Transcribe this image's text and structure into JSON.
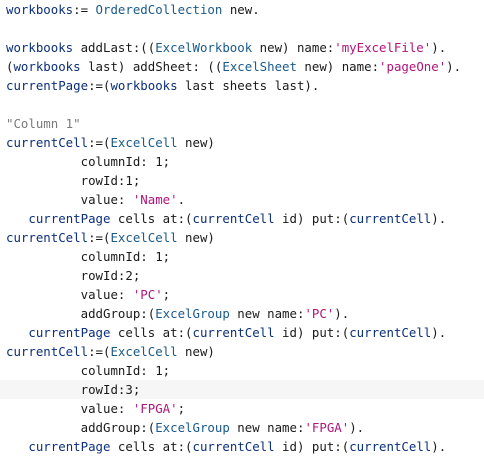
{
  "editor": {
    "lines": [
      {
        "indent": "",
        "tokens": [
          [
            "v",
            "workbooks"
          ],
          [
            "n",
            ":= "
          ],
          [
            "c",
            "OrderedCollection"
          ],
          [
            "n",
            " new."
          ]
        ]
      },
      {
        "indent": "",
        "tokens": []
      },
      {
        "indent": "",
        "tokens": [
          [
            "v",
            "workbooks"
          ],
          [
            "n",
            " addLast:(("
          ],
          [
            "c",
            "ExcelWorkbook"
          ],
          [
            "n",
            " new) name:"
          ],
          [
            "s",
            "'myExcelFile'"
          ],
          [
            "n",
            ")."
          ]
        ]
      },
      {
        "indent": "",
        "tokens": [
          [
            "n",
            "("
          ],
          [
            "v",
            "workbooks"
          ],
          [
            "n",
            " last) addSheet: (("
          ],
          [
            "c",
            "ExcelSheet"
          ],
          [
            "n",
            " new) name:"
          ],
          [
            "s",
            "'pageOne'"
          ],
          [
            "n",
            ")."
          ]
        ]
      },
      {
        "indent": "",
        "tokens": [
          [
            "v",
            "currentPage"
          ],
          [
            "n",
            ":=("
          ],
          [
            "v",
            "workbooks"
          ],
          [
            "n",
            " last sheets last)."
          ]
        ]
      },
      {
        "indent": "",
        "tokens": []
      },
      {
        "indent": "",
        "tokens": [
          [
            "k",
            "\"Column 1\""
          ]
        ]
      },
      {
        "indent": "",
        "tokens": [
          [
            "v",
            "currentCell"
          ],
          [
            "n",
            ":=("
          ],
          [
            "c",
            "ExcelCell"
          ],
          [
            "n",
            " new)"
          ]
        ]
      },
      {
        "indent": "          ",
        "tokens": [
          [
            "n",
            "columnId: 1;"
          ]
        ]
      },
      {
        "indent": "          ",
        "tokens": [
          [
            "n",
            "rowId:1;"
          ]
        ]
      },
      {
        "indent": "          ",
        "tokens": [
          [
            "n",
            "value: "
          ],
          [
            "s",
            "'Name'"
          ],
          [
            "n",
            "."
          ]
        ]
      },
      {
        "indent": "   ",
        "tokens": [
          [
            "v",
            "currentPage"
          ],
          [
            "n",
            " cells at:("
          ],
          [
            "v",
            "currentCell"
          ],
          [
            "n",
            " id) put:("
          ],
          [
            "v",
            "currentCell"
          ],
          [
            "n",
            ")."
          ]
        ]
      },
      {
        "indent": "",
        "tokens": [
          [
            "v",
            "currentCell"
          ],
          [
            "n",
            ":=("
          ],
          [
            "c",
            "ExcelCell"
          ],
          [
            "n",
            " new)"
          ]
        ]
      },
      {
        "indent": "          ",
        "tokens": [
          [
            "n",
            "columnId: 1;"
          ]
        ]
      },
      {
        "indent": "          ",
        "tokens": [
          [
            "n",
            "rowId:2;"
          ]
        ]
      },
      {
        "indent": "          ",
        "tokens": [
          [
            "n",
            "value: "
          ],
          [
            "s",
            "'PC'"
          ],
          [
            "n",
            ";"
          ]
        ]
      },
      {
        "indent": "          ",
        "tokens": [
          [
            "n",
            "addGroup:("
          ],
          [
            "c",
            "ExcelGroup"
          ],
          [
            "n",
            " new name:"
          ],
          [
            "s",
            "'PC'"
          ],
          [
            "n",
            ")."
          ]
        ]
      },
      {
        "indent": "   ",
        "tokens": [
          [
            "v",
            "currentPage"
          ],
          [
            "n",
            " cells at:("
          ],
          [
            "v",
            "currentCell"
          ],
          [
            "n",
            " id) put:("
          ],
          [
            "v",
            "currentCell"
          ],
          [
            "n",
            ")."
          ]
        ]
      },
      {
        "indent": "",
        "tokens": [
          [
            "v",
            "currentCell"
          ],
          [
            "n",
            ":=("
          ],
          [
            "c",
            "ExcelCell"
          ],
          [
            "n",
            " new)"
          ]
        ]
      },
      {
        "indent": "          ",
        "tokens": [
          [
            "n",
            "columnId: 1;"
          ]
        ]
      },
      {
        "indent": "          ",
        "tokens": [
          [
            "n",
            "rowId:3;"
          ]
        ],
        "highlight": true
      },
      {
        "indent": "          ",
        "tokens": [
          [
            "n",
            "value: "
          ],
          [
            "s",
            "'FPGA'"
          ],
          [
            "n",
            ";"
          ]
        ]
      },
      {
        "indent": "          ",
        "tokens": [
          [
            "n",
            "addGroup:("
          ],
          [
            "c",
            "ExcelGroup"
          ],
          [
            "n",
            " new name:"
          ],
          [
            "s",
            "'FPGA'"
          ],
          [
            "n",
            ")."
          ]
        ]
      },
      {
        "indent": "   ",
        "tokens": [
          [
            "v",
            "currentPage"
          ],
          [
            "n",
            " cells at:("
          ],
          [
            "v",
            "currentCell"
          ],
          [
            "n",
            " id) put:("
          ],
          [
            "v",
            "currentCell"
          ],
          [
            "n",
            ")."
          ]
        ]
      }
    ]
  }
}
